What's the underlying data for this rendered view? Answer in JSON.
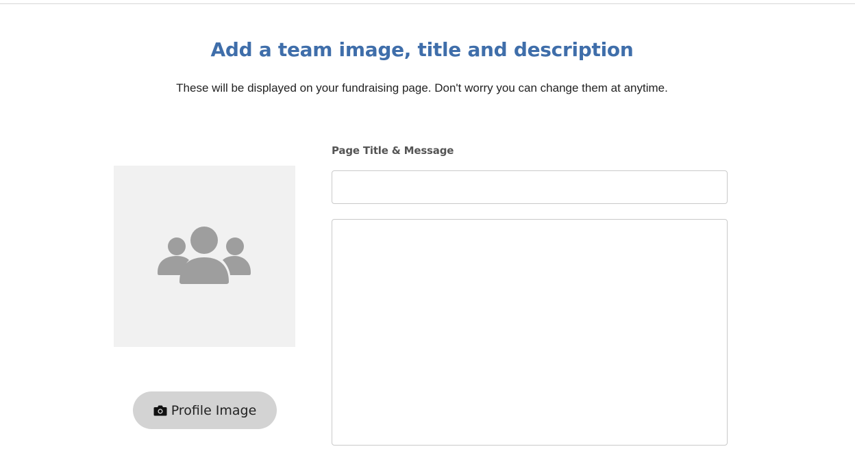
{
  "header": {
    "title": "Add a team image, title and description",
    "subtitle": "These will be displayed on your fundraising page. Don't worry you can change them at anytime."
  },
  "image_panel": {
    "placeholder_icon": "team-icon",
    "upload_button": {
      "icon": "camera-icon",
      "label": "Profile Image"
    }
  },
  "form": {
    "label": "Page Title & Message",
    "title_input": {
      "value": "",
      "placeholder": ""
    },
    "message_textarea": {
      "value": "",
      "placeholder": ""
    }
  },
  "colors": {
    "heading": "#3f6eaa",
    "image_bg": "#f1f1f1",
    "icon": "#9e9e9e",
    "button_bg": "#d3d3d3"
  }
}
